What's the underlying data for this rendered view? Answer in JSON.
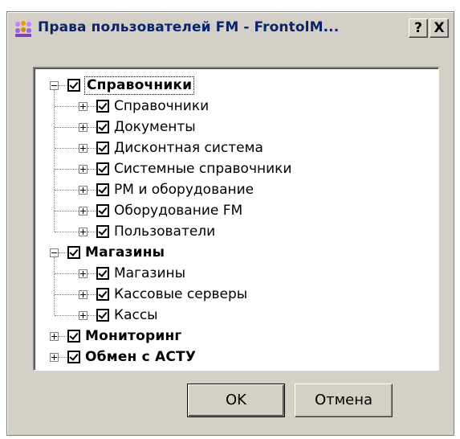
{
  "window": {
    "title": "Права пользователей FM - FrontolM...",
    "help_label": "?",
    "close_label": "X",
    "icon": "users-icon"
  },
  "tree": {
    "groups": [
      {
        "label": "Справочники",
        "expanded": true,
        "checked": true,
        "children": [
          "Справочники",
          "Документы",
          "Дисконтная система",
          "Системные справочники",
          "РМ и оборудование",
          "Оборудование FM",
          "Пользователи"
        ]
      },
      {
        "label": "Магазины",
        "expanded": true,
        "checked": true,
        "children": [
          "Магазины",
          "Кассовые серверы",
          "Кассы"
        ]
      },
      {
        "label": "Мониторинг",
        "expanded": false,
        "checked": true,
        "children": []
      },
      {
        "label": "Обмен с АСТУ",
        "expanded": false,
        "checked": true,
        "children": []
      }
    ]
  },
  "buttons": {
    "ok_label": "OK",
    "cancel_label": "Отмена"
  }
}
